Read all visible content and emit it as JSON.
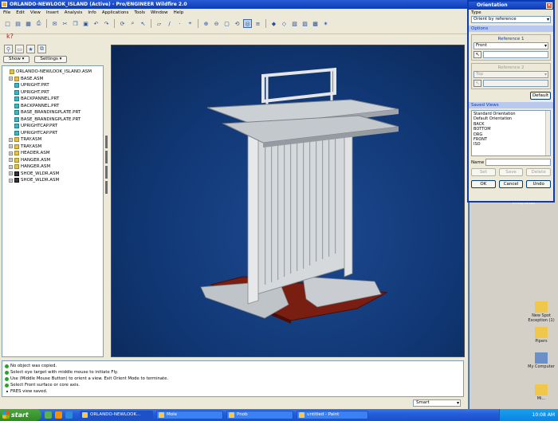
{
  "window": {
    "title": "ORLANDO-NEWLOOK_ISLAND (Active) - Pro/ENGINEER Wildfire 2.0"
  },
  "menu": [
    "File",
    "Edit",
    "View",
    "Insert",
    "Analysis",
    "Info",
    "Applications",
    "Tools",
    "Window",
    "Help"
  ],
  "toolbar": {
    "icons": [
      "new-icon",
      "open-icon",
      "save-icon",
      "print-icon",
      "email-icon",
      "cut-icon",
      "copy-icon",
      "paste-icon",
      "undo-icon",
      "redo-icon",
      "regenerate-icon",
      "find-icon",
      "select-icon",
      "datum-plane-icon",
      "datum-axis-icon",
      "datum-point-icon",
      "coordinate-system-icon",
      "zoom-in-icon",
      "zoom-out-icon",
      "refit-icon",
      "reorient-icon",
      "saved-views-icon",
      "layers-icon",
      "shading-icon",
      "wireframe-icon",
      "hidden-line-icon",
      "no-hidden-icon",
      "shaded-icon",
      "spin-center-icon"
    ],
    "context_help": "k?"
  },
  "navigator": {
    "show_label": "Show ▾",
    "settings_label": "Settings ▾",
    "tree": [
      {
        "label": "ORLANDO-NEWLOOK_ISLAND.ASM",
        "type": "asm",
        "level": 0,
        "exp": false
      },
      {
        "label": "BASE.ASM",
        "type": "asm",
        "level": 1,
        "exp": true
      },
      {
        "label": "UPRIGHT.PRT",
        "type": "prt",
        "level": 1,
        "exp": false
      },
      {
        "label": "UPRIGHT.PRT",
        "type": "prt",
        "level": 1,
        "exp": false
      },
      {
        "label": "BACKPANNEL.PRT",
        "type": "prt",
        "level": 1,
        "exp": false
      },
      {
        "label": "BACKPANNEL.PRT",
        "type": "prt",
        "level": 1,
        "exp": false
      },
      {
        "label": "BASE_BRANDINGPLATE.PRT",
        "type": "prt",
        "level": 1,
        "exp": false
      },
      {
        "label": "BASE_BRANDINGPLATE.PRT",
        "type": "prt",
        "level": 1,
        "exp": false
      },
      {
        "label": "UPRIGHTCAP.PRT",
        "type": "prt",
        "level": 1,
        "exp": false
      },
      {
        "label": "UPRIGHTCAP.PRT",
        "type": "prt",
        "level": 1,
        "exp": false
      },
      {
        "label": "TRAY.ASM",
        "type": "asm",
        "level": 1,
        "exp": true
      },
      {
        "label": "TRAY.ASM",
        "type": "asm",
        "level": 1,
        "exp": true
      },
      {
        "label": "HEADER.ASM",
        "type": "asm",
        "level": 1,
        "exp": true
      },
      {
        "label": "HANGER.ASM",
        "type": "asm",
        "level": 1,
        "exp": true
      },
      {
        "label": "HANGER.ASM",
        "type": "asm",
        "level": 1,
        "exp": true
      },
      {
        "label": "SHOE_WLDR.ASM",
        "type": "dark",
        "level": 1,
        "exp": true
      },
      {
        "label": "SHOE_WLDR.ASM",
        "type": "dark",
        "level": 1,
        "exp": true
      }
    ]
  },
  "messages": [
    {
      "text": "No object was copied.",
      "bullet": false
    },
    {
      "text": "Select eye target with middle mouse to initiate Fly.",
      "bullet": false
    },
    {
      "text": "Use (Middle Mouse Button) to orient a view. Exit Orient Mode to terminate.",
      "bullet": false
    },
    {
      "text": "Select Front surface or core axis.",
      "bullet": false
    },
    {
      "text": "FRES view saved.",
      "bullet": true
    }
  ],
  "filter": {
    "value": "Smart"
  },
  "dialog": {
    "title": "Orientation",
    "type_label": "Type",
    "type_value": "Orient by reference",
    "options_label": "Options",
    "reference1_label": "Reference 1",
    "reference1_value": "Front",
    "reference2_label": "Reference 2",
    "reference2_value": "Top",
    "default_button": "Default",
    "saved_views_label": "Saved Views",
    "saved_views": [
      "Standard Orientation",
      "Default Orientation",
      "BACK",
      "BOTTOM",
      "DRG",
      "FRONT",
      "ISO"
    ],
    "name_label": "Name",
    "set_button": "Set",
    "save_button": "Save",
    "delete_button": "Delete",
    "ok_button": "OK",
    "cancel_button": "Cancel",
    "undo_button": "Undo"
  },
  "desktop": {
    "partial_label": "Print/fields",
    "icons": [
      {
        "label": "New Spot Exception (1)",
        "icon": "folder-icon"
      },
      {
        "label": "Pipers",
        "icon": "folder-icon"
      },
      {
        "label": "My Computer",
        "icon": "computer-icon"
      },
      {
        "label": "Mi...",
        "icon": "folder-icon"
      }
    ]
  },
  "taskbar": {
    "start_label": "start",
    "tasks": [
      {
        "label": "ORLANDO-NEWLOOK...",
        "active": true
      },
      {
        "label": "Mole",
        "active": false
      },
      {
        "label": "Pnob",
        "active": false
      },
      {
        "label": "untitled - Paint",
        "active": false
      }
    ],
    "clock": "10:08 AM"
  },
  "colors": {
    "viewport_bg": "#113875",
    "base_plate": "#7a1e12",
    "model": "#cfd3d6"
  }
}
